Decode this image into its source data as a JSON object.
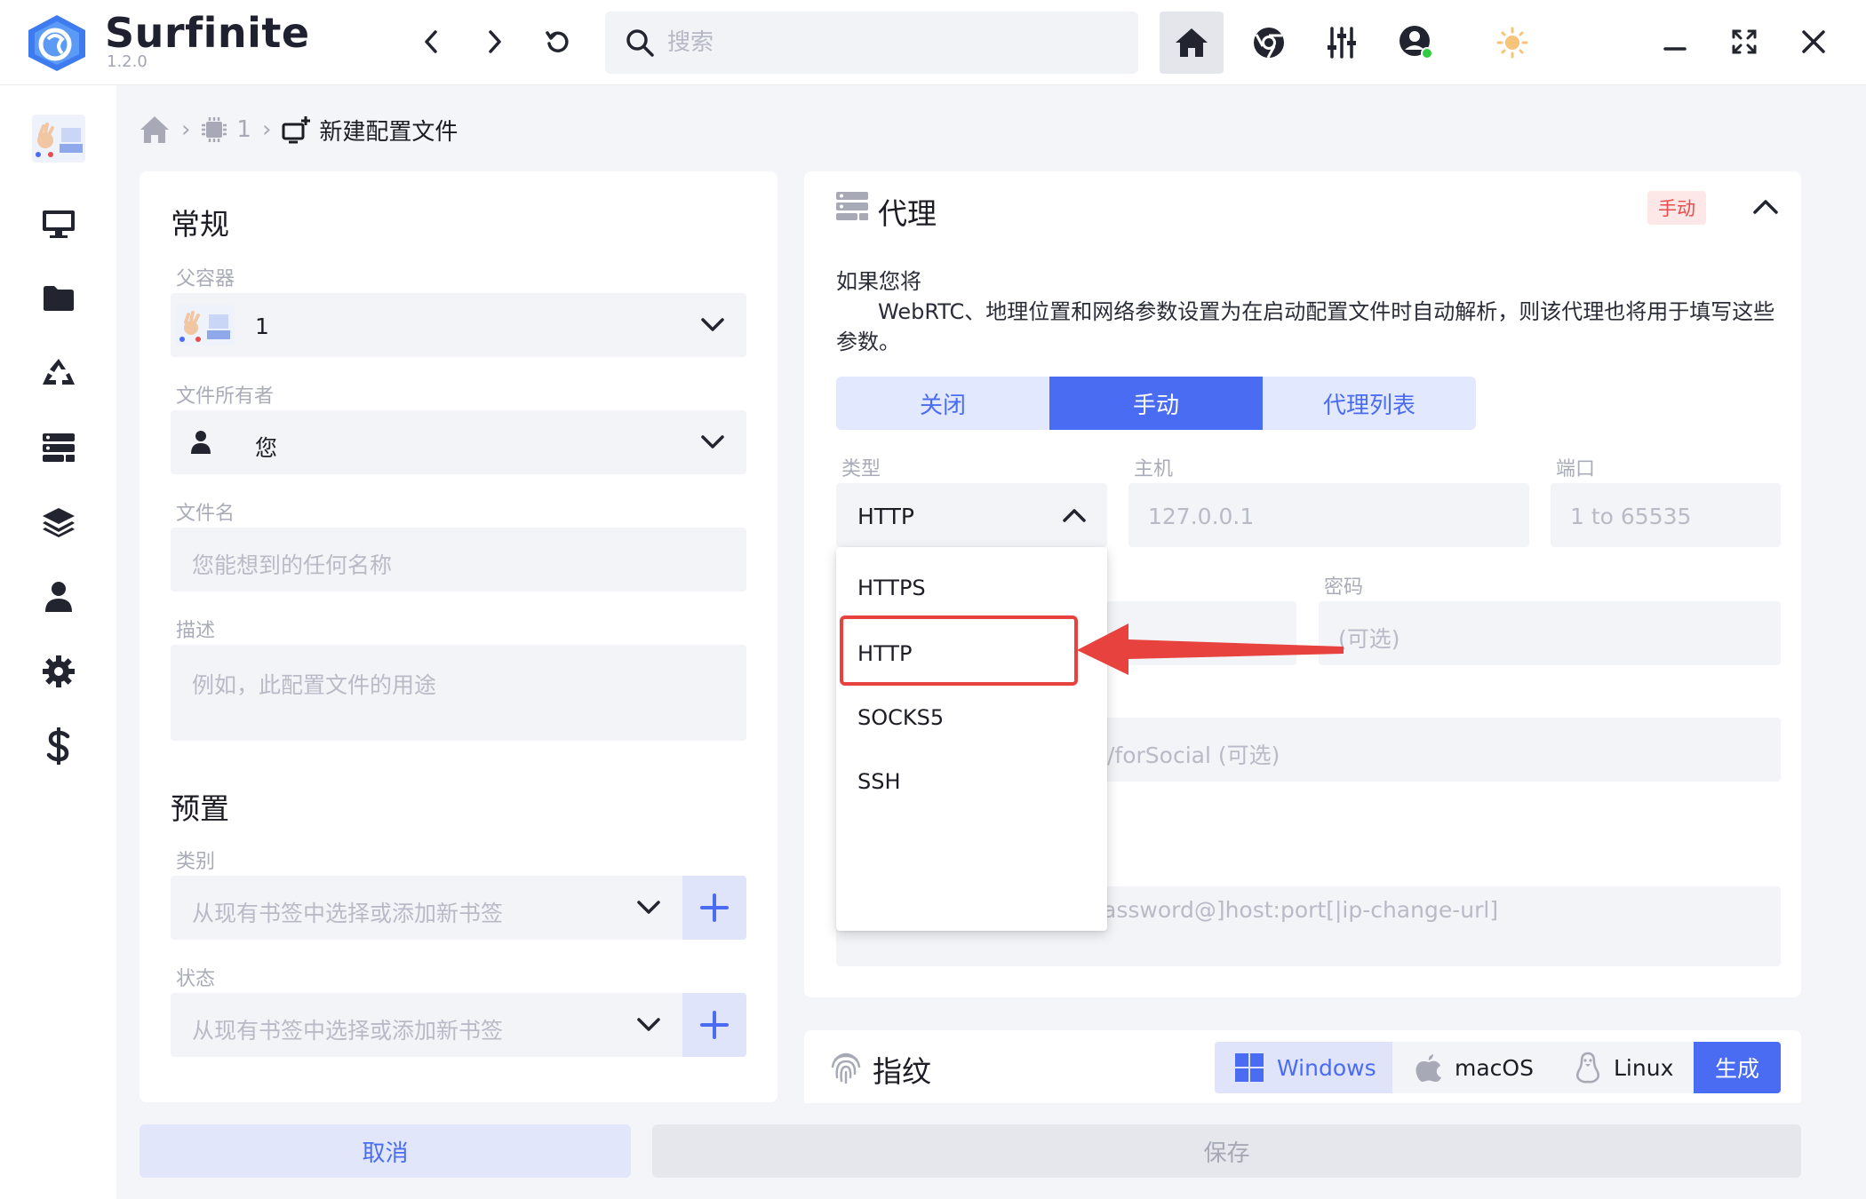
{
  "app": {
    "name": "Surfinite",
    "version": "1.2.0"
  },
  "search": {
    "placeholder": "搜索"
  },
  "colors": {
    "accent": "#4a6cf2",
    "badge_red": "#e84c4c",
    "highlight": "#e8423f",
    "online": "#2ecc40",
    "sun": "#f5b041"
  },
  "sidebar": {
    "items": [
      {
        "icon": "avatar-thumbnail"
      },
      {
        "icon": "monitor-icon"
      },
      {
        "icon": "folder-icon"
      },
      {
        "icon": "recycle-icon"
      },
      {
        "icon": "server-icon"
      },
      {
        "icon": "layers-icon"
      },
      {
        "icon": "user-icon"
      },
      {
        "icon": "gear-icon"
      },
      {
        "icon": "dollar-icon"
      }
    ]
  },
  "breadcrumb": {
    "step1": "1",
    "current": "新建配置文件"
  },
  "general": {
    "title": "常规",
    "parent_label": "父容器",
    "parent_value": "1",
    "owner_label": "文件所有者",
    "owner_value": "您",
    "filename_label": "文件名",
    "filename_placeholder": "您能想到的任何名称",
    "desc_label": "描述",
    "desc_placeholder": "例如，此配置文件的用途"
  },
  "preset": {
    "title": "预置",
    "category_label": "类别",
    "category_placeholder": "从现有书签中选择或添加新书签",
    "status_label": "状态",
    "status_placeholder": "从现有书签中选择或添加新书签"
  },
  "proxy": {
    "title": "代理",
    "badge": "手动",
    "desc_line1": "如果您将",
    "desc_line2": "WebRTC、地理位置和网络参数设置为在启动配置文件时自动解析，则该代理也将用于填写这些参数。",
    "seg_off": "关闭",
    "seg_manual": "手动",
    "seg_list": "代理列表",
    "type_label": "类型",
    "type_value": "HTTP",
    "host_label": "主机",
    "host_placeholder": "127.0.0.1",
    "port_label": "端口",
    "port_placeholder": "1 to 65535",
    "password_label": "密码",
    "password_placeholder": "(可选)",
    "change_ip_fragment": "/forSocial (可选)",
    "paste_fragment": "assword@]host:port[|ip-change-url]",
    "dropdown_options": [
      "HTTPS",
      "HTTP",
      "SOCKS5",
      "SSH"
    ]
  },
  "fingerprint": {
    "title": "指纹",
    "windows": "Windows",
    "macos": "macOS",
    "linux": "Linux",
    "generate": "生成"
  },
  "footer": {
    "cancel": "取消",
    "save": "保存"
  }
}
